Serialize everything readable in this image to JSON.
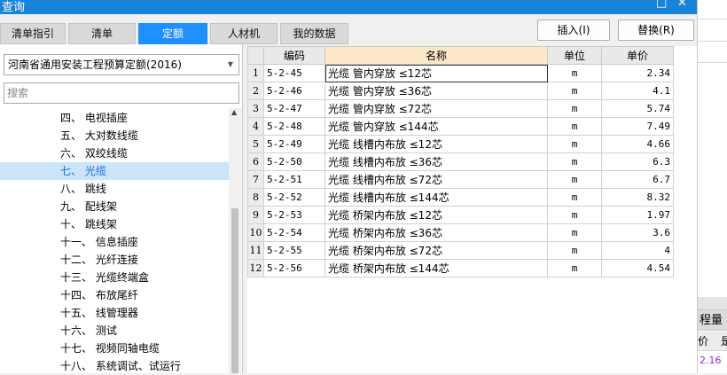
{
  "window": {
    "title": "查询",
    "controls": [
      "□",
      "✕"
    ]
  },
  "tabs": [
    {
      "label": "清单指引",
      "active": false
    },
    {
      "label": "清单",
      "active": false
    },
    {
      "label": "定额",
      "active": true
    },
    {
      "label": "人材机",
      "active": false
    },
    {
      "label": "我的数据",
      "active": false
    }
  ],
  "buttons": {
    "insert": "插入(I)",
    "replace": "替换(R)"
  },
  "library": {
    "selected": "河南省通用安装工程预算定额(2016)"
  },
  "search": {
    "placeholder": "搜索",
    "value": ""
  },
  "tree": {
    "items": [
      {
        "label": "四、 电视插座"
      },
      {
        "label": "五、 大对数线缆"
      },
      {
        "label": "六、 双绞线缆"
      },
      {
        "label": "七、 光缆"
      },
      {
        "label": "八、 跳线"
      },
      {
        "label": "九、 配线架"
      },
      {
        "label": "十、 跳线架"
      },
      {
        "label": "十一、 信息插座"
      },
      {
        "label": "十二、 光纤连接"
      },
      {
        "label": "十三、 光缆终端盒"
      },
      {
        "label": "十四、 布放尾纤"
      },
      {
        "label": "十五、 线管理器"
      },
      {
        "label": "十六、 测试"
      },
      {
        "label": "十七、 视频同轴电缆"
      },
      {
        "label": "十八、 系统调试、试运行"
      }
    ],
    "selected_index": 3
  },
  "grid": {
    "columns": [
      "编码",
      "名称",
      "单位",
      "单价"
    ],
    "rows": [
      {
        "no": "1",
        "code": "5-2-45",
        "name": "光缆 管内穿放 ≤12芯",
        "unit": "m",
        "price": "2.34"
      },
      {
        "no": "2",
        "code": "5-2-46",
        "name": "光缆 管内穿放 ≤36芯",
        "unit": "m",
        "price": "4.1"
      },
      {
        "no": "3",
        "code": "5-2-47",
        "name": "光缆 管内穿放 ≤72芯",
        "unit": "m",
        "price": "5.74"
      },
      {
        "no": "4",
        "code": "5-2-48",
        "name": "光缆 管内穿放 ≤144芯",
        "unit": "m",
        "price": "7.49"
      },
      {
        "no": "5",
        "code": "5-2-49",
        "name": "光缆 线槽内布放 ≤12芯",
        "unit": "m",
        "price": "4.66"
      },
      {
        "no": "6",
        "code": "5-2-50",
        "name": "光缆 线槽内布放 ≤36芯",
        "unit": "m",
        "price": "6.3"
      },
      {
        "no": "7",
        "code": "5-2-51",
        "name": "光缆 线槽内布放 ≤72芯",
        "unit": "m",
        "price": "6.7"
      },
      {
        "no": "8",
        "code": "5-2-52",
        "name": "光缆 线槽内布放 ≤144芯",
        "unit": "m",
        "price": "8.32"
      },
      {
        "no": "9",
        "code": "5-2-53",
        "name": "光缆 桥架内布放 ≤12芯",
        "unit": "m",
        "price": "1.97"
      },
      {
        "no": "10",
        "code": "5-2-54",
        "name": "光缆 桥架内布放 ≤36芯",
        "unit": "m",
        "price": "3.6"
      },
      {
        "no": "11",
        "code": "5-2-55",
        "name": "光缆 桥架内布放 ≤72芯",
        "unit": "m",
        "price": "4"
      },
      {
        "no": "12",
        "code": "5-2-56",
        "name": "光缆 桥架内布放 ≤144芯",
        "unit": "m",
        "price": "4.54"
      }
    ]
  },
  "background_window": {
    "label": "程量",
    "col": "价",
    "col2": "是",
    "value": "2.16"
  },
  "colors": {
    "title_bar": "#1883d7",
    "active_tab": "#1e90ff",
    "selected_tree": "#cce4f7",
    "name_header": "#fde7c9"
  }
}
